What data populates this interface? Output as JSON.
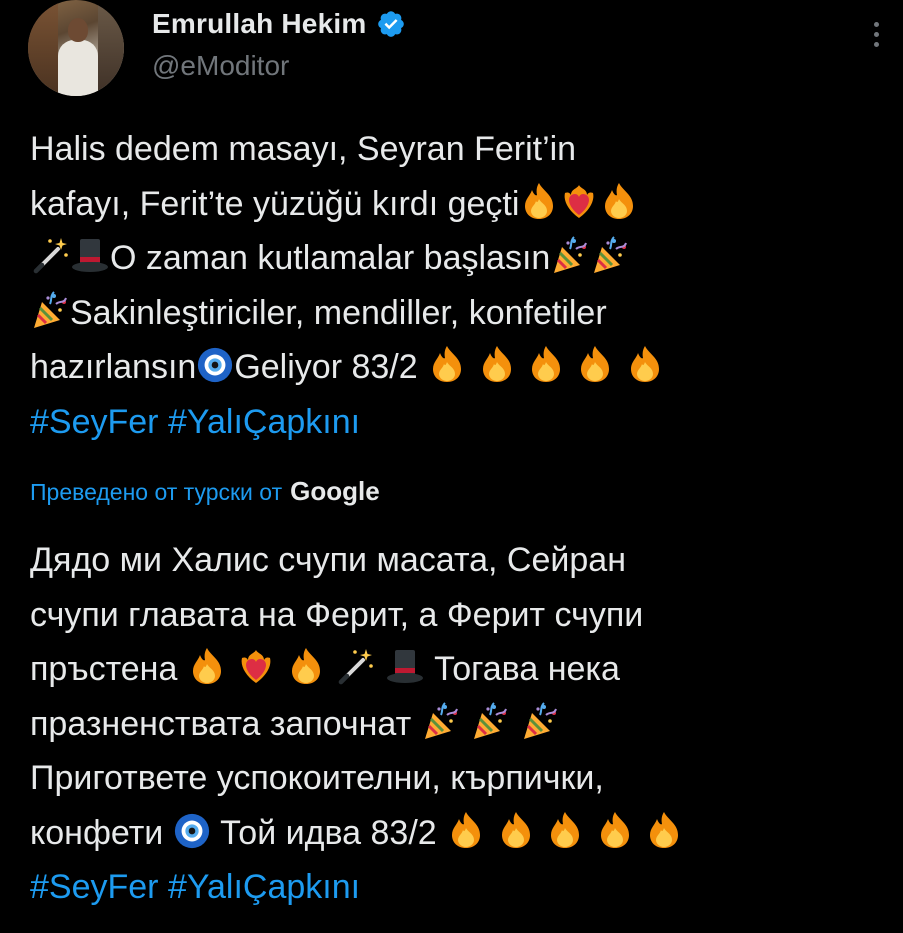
{
  "author": {
    "display_name": "Emrullah Hekim",
    "handle": "@eModitor",
    "verified": true
  },
  "tweet": {
    "line1": "Halis dedem masayı, Seyran Ferit’in",
    "line2_a": "kafayı, Ferit’te yüzüğü kırdı geçti",
    "line3_b": "O zaman kutlamalar başlasın",
    "line4_b": "Sakinleştiriciler, mendiller, konfetiler",
    "line5_a": "hazırlansın",
    "line5_b": "Geliyor 83/2",
    "hashtags": [
      "#SeyFer",
      "#YalıÇapkını"
    ]
  },
  "translation": {
    "label": "Преведено от турски от",
    "provider": "Google",
    "line1": "Дядо ми Халис счупи масата, Сейран",
    "line2": "счупи главата на Ферит, а Ферит счупи",
    "line3_a": "пръстена",
    "line3_b": "Тогава нека",
    "line4_a": "празненствата започнат",
    "line5": "Пригответе успокоителни, кърпички,",
    "line6_a": "конфети",
    "line6_b": "Той идва 83/2",
    "hashtags": [
      "#SeyFer",
      "#YalıÇapkını"
    ]
  },
  "colors": {
    "background": "#000000",
    "text": "#e7e9ea",
    "secondary_text": "#71767b",
    "link": "#1d9bf0"
  },
  "icons": {
    "verified": "verified-badge-icon",
    "more": "more-vertical-icon",
    "fire": "fire-emoji",
    "heart_on_fire": "heart-on-fire-emoji",
    "magic_wand": "magic-wand-emoji",
    "top_hat": "top-hat-emoji",
    "party_popper": "party-popper-emoji",
    "nazar": "nazar-amulet-emoji"
  }
}
